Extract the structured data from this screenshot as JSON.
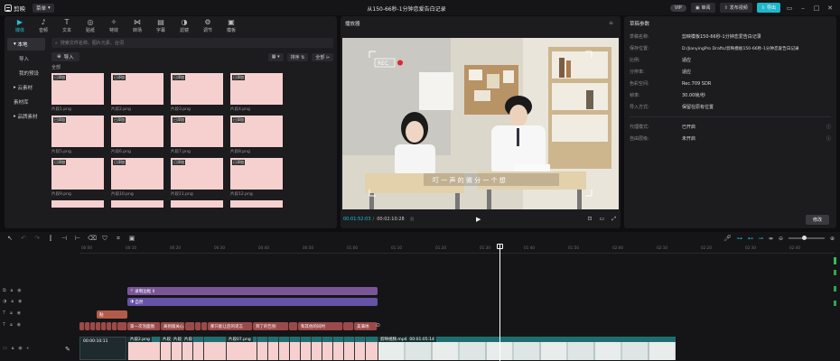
{
  "app": {
    "name": "剪映",
    "menu": "菜单",
    "title": "从150-66秒-1分钟恋爱告白记录"
  },
  "topbar": {
    "vip": "VIP",
    "share": "审阅",
    "publish": "发布视频",
    "export": "导出"
  },
  "media_tabs": [
    {
      "label": "媒体",
      "icon": "media-icon",
      "glyph": "▶"
    },
    {
      "label": "音频",
      "icon": "audio-icon",
      "glyph": "♪"
    },
    {
      "label": "文本",
      "icon": "text-icon",
      "glyph": "T"
    },
    {
      "label": "贴纸",
      "icon": "sticker-icon",
      "glyph": "◎"
    },
    {
      "label": "特效",
      "icon": "effects-icon",
      "glyph": "✧"
    },
    {
      "label": "转场",
      "icon": "transition-icon",
      "glyph": "⋈"
    },
    {
      "label": "字幕",
      "icon": "caption-icon",
      "glyph": "▤"
    },
    {
      "label": "滤镜",
      "icon": "filter-icon",
      "glyph": "◑"
    },
    {
      "label": "调节",
      "icon": "adjust-icon",
      "glyph": "⚙"
    },
    {
      "label": "模板",
      "icon": "template-icon",
      "glyph": "▣"
    }
  ],
  "media_side": [
    {
      "label": "本地",
      "active": true
    },
    {
      "label": "导入",
      "sub": true
    },
    {
      "label": "我的预设",
      "sub": true
    },
    {
      "label": "云素材"
    },
    {
      "label": "素材库"
    },
    {
      "label": "品牌素材"
    }
  ],
  "media_main": {
    "search_placeholder": "搜索文件名称、图片元素、台词",
    "import": "导入",
    "sort": "排序",
    "filter": "全部",
    "all_label": "全部",
    "thumbs": [
      {
        "caption": "片段1.png",
        "tag": "已添加"
      },
      {
        "caption": "片段2.png",
        "tag": "已添加"
      },
      {
        "caption": "片段3.png",
        "tag": "已添加"
      },
      {
        "caption": "片段4.png",
        "tag": "已添加"
      },
      {
        "caption": "片段5.png",
        "tag": "已添加"
      },
      {
        "caption": "片段6.png",
        "tag": "已添加"
      },
      {
        "caption": "片段7.png",
        "tag": "已添加"
      },
      {
        "caption": "片段8.png",
        "tag": "已添加"
      },
      {
        "caption": "片段9.png",
        "tag": "已添加"
      },
      {
        "caption": "片段10.png",
        "tag": "已添加"
      },
      {
        "caption": "片段11.png",
        "tag": "已添加"
      },
      {
        "caption": "片段12.png",
        "tag": "已添加"
      },
      {
        "caption": "",
        "tag": ""
      },
      {
        "caption": "",
        "tag": ""
      },
      {
        "caption": "",
        "tag": ""
      },
      {
        "caption": "",
        "tag": ""
      }
    ]
  },
  "player": {
    "title": "播放器",
    "rec": "REC",
    "subtitle": "叮 一 声 的 微 分 一 个 想",
    "time_current": "00:01:52:03",
    "time_total": "00:02:10:28"
  },
  "props": {
    "title": "草稿参数",
    "rows": [
      {
        "label": "草稿名称:",
        "value": "剪映模板150-66秒-1分钟恋爱告白记录"
      },
      {
        "label": "保存位置:",
        "value": "D:/JianyingPro Drafts/剪映模板150-66秒-1分钟恋爱告白记录"
      },
      {
        "label": "比例:",
        "value": "适应"
      },
      {
        "label": "分辨率:",
        "value": "适应"
      },
      {
        "label": "色彩空间:",
        "value": "Rec.709 SDR"
      },
      {
        "label": "帧率:",
        "value": "30.00帧/秒"
      },
      {
        "label": "导入方式:",
        "value": "保留在原有位置"
      }
    ],
    "rows2": [
      {
        "label": "代理模式:",
        "value": "已开启"
      },
      {
        "label": "自由层级:",
        "value": "未开启"
      }
    ],
    "edit": "修改"
  },
  "timeline": {
    "ruler": [
      "00:00",
      "00:10",
      "00:20",
      "00:30",
      "00:40",
      "00:50",
      "01:00",
      "01:10",
      "01:20",
      "01:30",
      "01:40",
      "01:50",
      "02:00",
      "02:10",
      "02:20",
      "02:30",
      "02:40",
      "02:50",
      "03:00"
    ],
    "fx1": "录制边框 II",
    "fx2": "自然",
    "sticker": "贴",
    "texts": [
      "",
      "第一次泡面图",
      "离别版关心",
      "那只能让后的诺言",
      "到了的告别",
      "做一个恋爱",
      "走路摸就时",
      "最短极速还有",
      "和其他的同时",
      "人会还是好问",
      "美满地",
      "也在一起了"
    ],
    "main_cover": "封面",
    "main_time": "00:00:10:11",
    "main_clips": [
      "",
      "片段2.png",
      "片段",
      "片段",
      "片段",
      "片段07.png",
      "片段",
      "片段",
      "片段",
      "片段",
      "片段",
      "片段",
      "片段"
    ],
    "video_clip": "剪映视频.mp4",
    "video_time": "00:01:05:14"
  }
}
